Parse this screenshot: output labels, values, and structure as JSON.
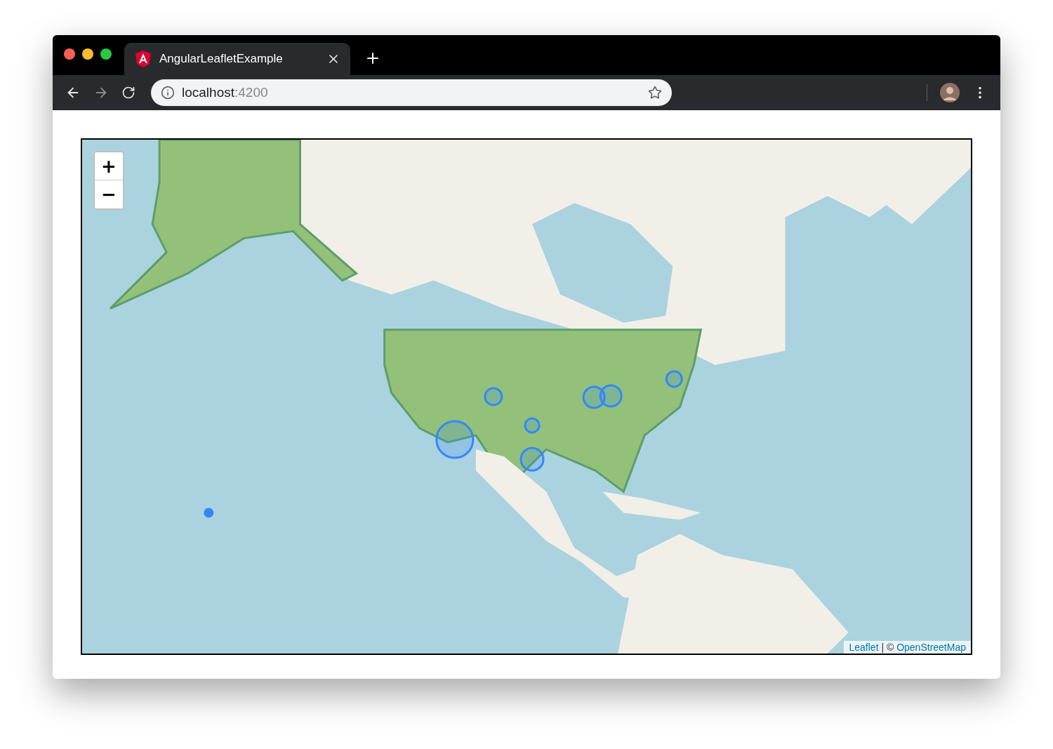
{
  "browser": {
    "tab": {
      "title": "AngularLeafletExample",
      "selected": true
    },
    "navigation": {
      "back_disabled": false,
      "forward_disabled": true
    },
    "address": {
      "host": "localhost",
      "port": ":4200"
    }
  },
  "map": {
    "kind": "picture",
    "zoom_in": "+",
    "zoom_out": "−",
    "attribution": {
      "first_link": "Leaflet",
      "separator": " | © ",
      "second_link": "OpenStreetMap"
    }
  }
}
